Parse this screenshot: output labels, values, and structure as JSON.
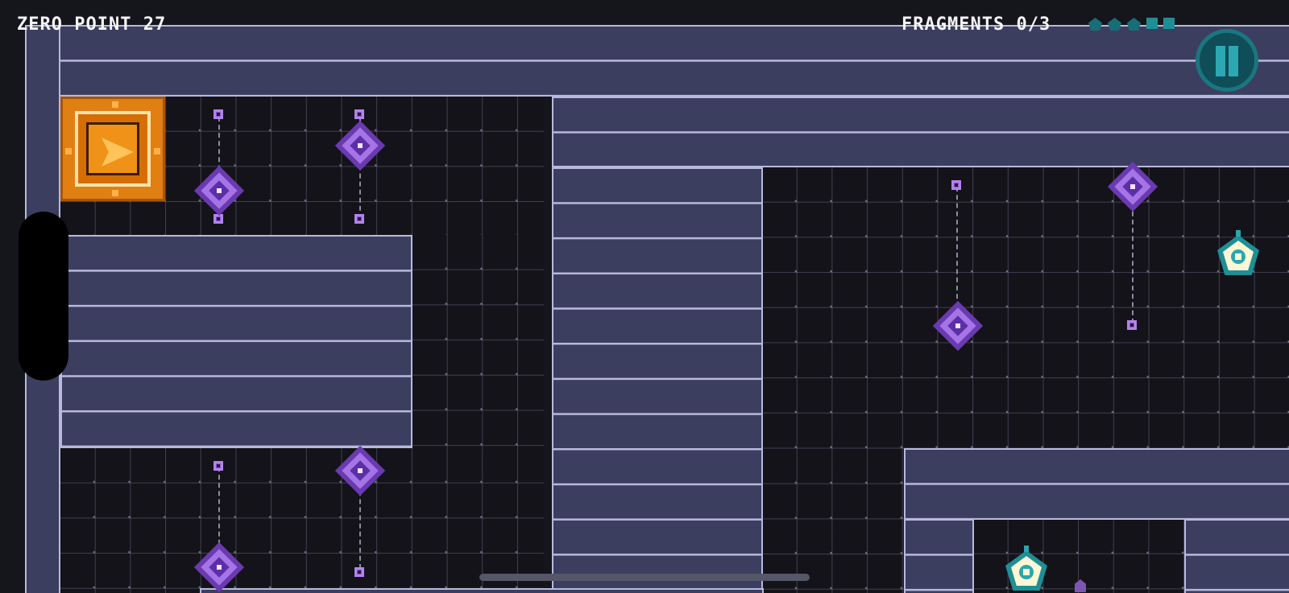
{
  "hud": {
    "level_label": "ZERO POINT 27",
    "fragments_label": "FRAGMENTS 0/3",
    "fragments_collected": 0,
    "fragments_total": 3,
    "progress_indicator_count": 5
  },
  "colors": {
    "background": "#15151c",
    "floor": "#141319",
    "wall_fill": "#3c3e5f",
    "wall_edge": "#b8b9dc",
    "start_pad": "#e07f12",
    "sentry": "#a575e8",
    "fragment": "#1e8f95",
    "pause": "#1a7680"
  },
  "icons": {
    "pause": "pause-icon",
    "player": "arrow-ship-icon",
    "sentry": "diamond-sentry-icon",
    "fragment": "pentagon-fragment-icon"
  }
}
